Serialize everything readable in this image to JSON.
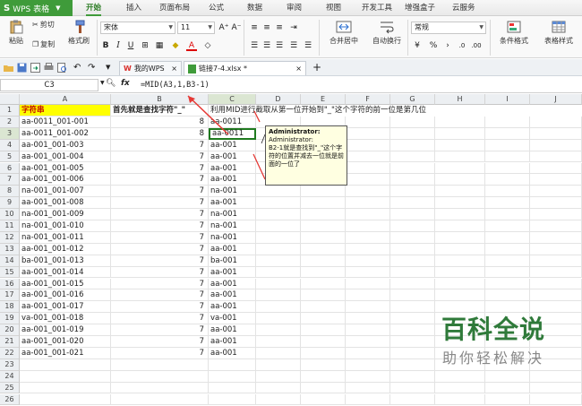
{
  "app": {
    "name": "WPS 表格",
    "logo": "S"
  },
  "menu": [
    "开始",
    "插入",
    "页面布局",
    "公式",
    "数据",
    "审阅",
    "视图",
    "开发工具",
    "增强盒子",
    "云服务"
  ],
  "ribbon": {
    "paste": "粘贴",
    "cut": "剪切",
    "copy": "复制",
    "format_painter": "格式刷",
    "font_name": "宋体",
    "font_size": "11",
    "merge": "合并居中",
    "wrap": "自动换行",
    "number_format": "常规",
    "percent": "%",
    "cond_format": "条件格式",
    "table_style": "表格样式"
  },
  "tabs": [
    {
      "label": "我的WPS"
    },
    {
      "label": "链接7-4.xlsx *"
    }
  ],
  "formula_bar": {
    "cell_ref": "C3",
    "fx": "fx",
    "formula": "=MID(A3,1,B3-1)"
  },
  "columns": [
    "A",
    "B",
    "C",
    "D",
    "E",
    "F",
    "G",
    "H",
    "I",
    "J"
  ],
  "header_row": {
    "a": "字符串",
    "b": "首先就是查找字符\"_\"",
    "c": "利用MID进行截取从第一位开始到\"_\"这个字符的前一位是第几位"
  },
  "rows": [
    {
      "n": "2",
      "a": "aa-0011_001-001",
      "b": "8",
      "c": "aa-0011"
    },
    {
      "n": "3",
      "a": "aa-0011_001-002",
      "b": "8",
      "c": "aa-0011"
    },
    {
      "n": "4",
      "a": "aa-001_001-003",
      "b": "7",
      "c": "aa-001"
    },
    {
      "n": "5",
      "a": "aa-001_001-004",
      "b": "7",
      "c": "aa-001"
    },
    {
      "n": "6",
      "a": "aa-001_001-005",
      "b": "7",
      "c": "aa-001"
    },
    {
      "n": "7",
      "a": "aa-001_001-006",
      "b": "7",
      "c": "aa-001"
    },
    {
      "n": "8",
      "a": "na-001_001-007",
      "b": "7",
      "c": "na-001"
    },
    {
      "n": "9",
      "a": "aa-001_001-008",
      "b": "7",
      "c": "aa-001"
    },
    {
      "n": "10",
      "a": "na-001_001-009",
      "b": "7",
      "c": "na-001"
    },
    {
      "n": "11",
      "a": "na-001_001-010",
      "b": "7",
      "c": "na-001"
    },
    {
      "n": "12",
      "a": "na-001_001-011",
      "b": "7",
      "c": "na-001"
    },
    {
      "n": "13",
      "a": "aa-001_001-012",
      "b": "7",
      "c": "aa-001"
    },
    {
      "n": "14",
      "a": "ba-001_001-013",
      "b": "7",
      "c": "ba-001"
    },
    {
      "n": "15",
      "a": "aa-001_001-014",
      "b": "7",
      "c": "aa-001"
    },
    {
      "n": "16",
      "a": "aa-001_001-015",
      "b": "7",
      "c": "aa-001"
    },
    {
      "n": "17",
      "a": "aa-001_001-016",
      "b": "7",
      "c": "aa-001"
    },
    {
      "n": "18",
      "a": "aa-001_001-017",
      "b": "7",
      "c": "aa-001"
    },
    {
      "n": "19",
      "a": "va-001_001-018",
      "b": "7",
      "c": "va-001"
    },
    {
      "n": "20",
      "a": "aa-001_001-019",
      "b": "7",
      "c": "aa-001"
    },
    {
      "n": "21",
      "a": "aa-001_001-020",
      "b": "7",
      "c": "aa-001"
    },
    {
      "n": "22",
      "a": "aa-001_001-021",
      "b": "7",
      "c": "aa-001"
    },
    {
      "n": "23",
      "a": "",
      "b": "",
      "c": ""
    },
    {
      "n": "24",
      "a": "",
      "b": "",
      "c": ""
    },
    {
      "n": "25",
      "a": "",
      "b": "",
      "c": ""
    },
    {
      "n": "26",
      "a": "",
      "b": "",
      "c": ""
    }
  ],
  "comment": {
    "author1": "Administrator:",
    "author2": "Administrator:",
    "text": "B2-1就是查找到\"_\"这个字符的位置并减去一位就是前面的一位了"
  },
  "watermark": {
    "title": "百科全说",
    "subtitle": "助你轻松解决"
  },
  "colors": {
    "accent": "#3f9b3a",
    "header_fill": "#ffff00",
    "arrow": "#e53935",
    "selection": "#1f7a1f"
  }
}
